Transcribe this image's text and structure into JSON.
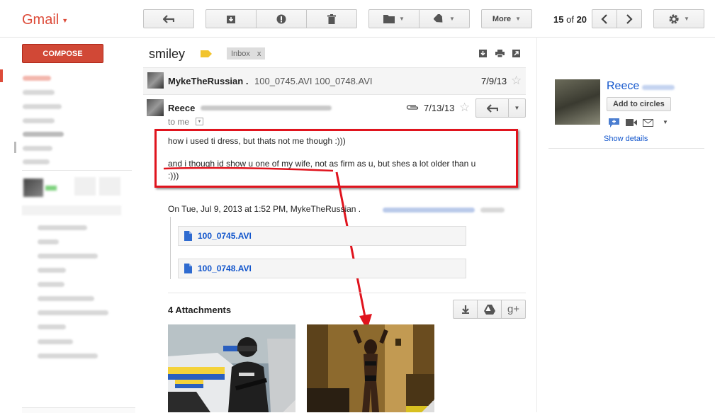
{
  "app": {
    "logo": "Gmail"
  },
  "toolbar": {
    "more_label": "More"
  },
  "pager": {
    "current": "15",
    "of": "of",
    "total": "20"
  },
  "compose_label": "COMPOSE",
  "thread": {
    "subject": "smiley",
    "label": "Inbox",
    "label_remove": "x",
    "messages": [
      {
        "sender": "MykeTheRussian .",
        "snippet": "100_0745.AVI 100_0748.AVI",
        "date": "7/9/13"
      },
      {
        "sender": "Reece",
        "date": "7/13/13",
        "to": "to me",
        "body": [
          "how i used ti dress, but thats not me though :)))",
          "and i though id show u one of my wife, not as firm as u, but shes a lot older than u",
          ":)))"
        ],
        "quote": "On Tue, Jul 9, 2013 at 1:52 PM, MykeTheRussian .",
        "quoted_attachments": [
          "100_0745.AVI",
          "100_0748.AVI"
        ]
      }
    ],
    "attachments_header": "4 Attachments"
  },
  "profile": {
    "name": "Reece",
    "add_circles": "Add to circles",
    "show_details": "Show details"
  },
  "colors": {
    "accent_red": "#dd4b39",
    "compose_red": "#d14836",
    "link_blue": "#1155cc",
    "annotation_red": "#e0141e"
  }
}
